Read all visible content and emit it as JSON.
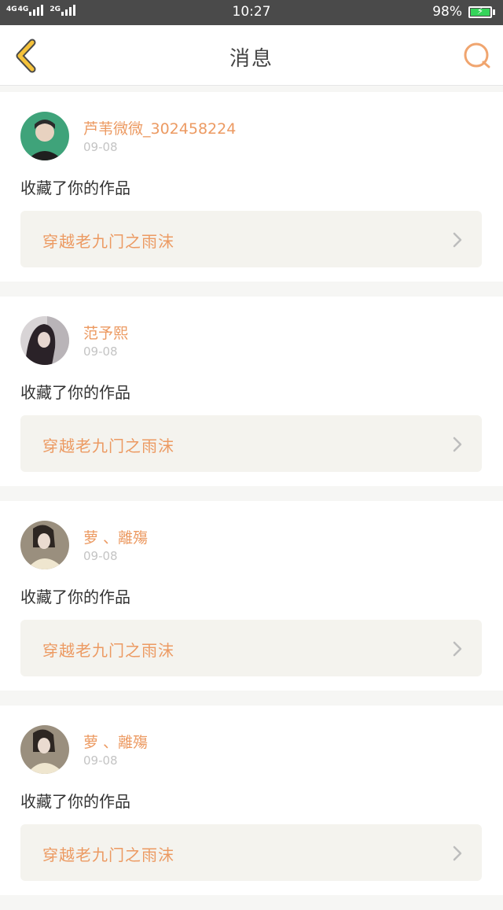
{
  "status_bar": {
    "network1": "4G",
    "network2": "4G",
    "network3": "2G",
    "time": "10:27",
    "battery_percent": "98%",
    "battery_level": 0.98,
    "battery_color": "#35d45a"
  },
  "header": {
    "title": "消息",
    "back_icon": "chevron-left-icon",
    "search_icon": "search-icon",
    "accent_color": "#f0a56f"
  },
  "messages": [
    {
      "username": "芦苇微微_302458224",
      "date": "09-08",
      "action": "收藏了你的作品",
      "work_title": "穿越老九门之雨沫"
    },
    {
      "username": "范予熙",
      "date": "09-08",
      "action": "收藏了你的作品",
      "work_title": "穿越老九门之雨沫"
    },
    {
      "username": "萝 、離殤",
      "date": "09-08",
      "action": "收藏了你的作品",
      "work_title": "穿越老九门之雨沫"
    },
    {
      "username": "萝 、離殤",
      "date": "09-08",
      "action": "收藏了你的作品",
      "work_title": "穿越老九门之雨沫"
    }
  ]
}
